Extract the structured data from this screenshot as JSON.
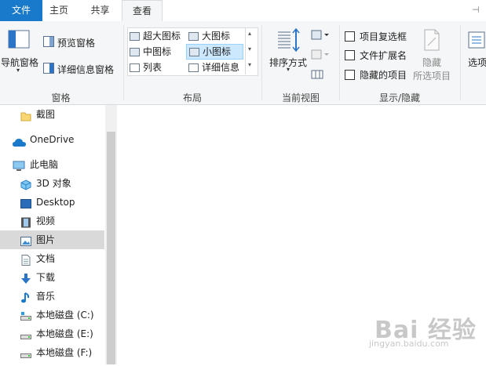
{
  "tabs": {
    "file": "文件",
    "home": "主页",
    "share": "共享",
    "view": "查看"
  },
  "ribbon": {
    "pane_group": {
      "nav_pane": "导航窗格",
      "preview_pane": "预览窗格",
      "details_pane": "详细信息窗格",
      "label": "窗格"
    },
    "layout_group": {
      "items": [
        "超大图标",
        "大图标",
        "中图标",
        "小图标",
        "列表",
        "详细信息"
      ],
      "selected": "小图标",
      "label": "布局"
    },
    "current_view_group": {
      "sort_by": "排序方式",
      "label": "当前视图"
    },
    "show_hide_group": {
      "item_checkboxes": "项目复选框",
      "file_extensions": "文件扩展名",
      "hidden_items": "隐藏的项目",
      "hide_selected_line1": "隐藏",
      "hide_selected_line2": "所选项目",
      "label": "显示/隐藏"
    },
    "options": "选项"
  },
  "nav": {
    "items": [
      {
        "label": "截图",
        "icon": "folder-icon"
      },
      {
        "label": "OneDrive",
        "icon": "cloud-icon"
      },
      {
        "label": "此电脑",
        "icon": "computer-icon"
      },
      {
        "label": "3D 对象",
        "icon": "3d-objects-icon"
      },
      {
        "label": "Desktop",
        "icon": "desktop-icon"
      },
      {
        "label": "视频",
        "icon": "video-icon"
      },
      {
        "label": "图片",
        "icon": "pictures-icon"
      },
      {
        "label": "文档",
        "icon": "documents-icon"
      },
      {
        "label": "下载",
        "icon": "download-icon"
      },
      {
        "label": "音乐",
        "icon": "music-icon"
      },
      {
        "label": "本地磁盘 (C:)",
        "icon": "drive-icon"
      },
      {
        "label": "本地磁盘 (E:)",
        "icon": "drive-icon"
      },
      {
        "label": "本地磁盘 (F:)",
        "icon": "drive-icon"
      }
    ],
    "selected": "图片"
  },
  "colors": {
    "accent": "#1979ca",
    "selection": "#cce8ff",
    "nav_selected": "#d9d9d9"
  },
  "watermark": {
    "main": "Bai 经验",
    "sub": "jingyan.baidu.com"
  }
}
